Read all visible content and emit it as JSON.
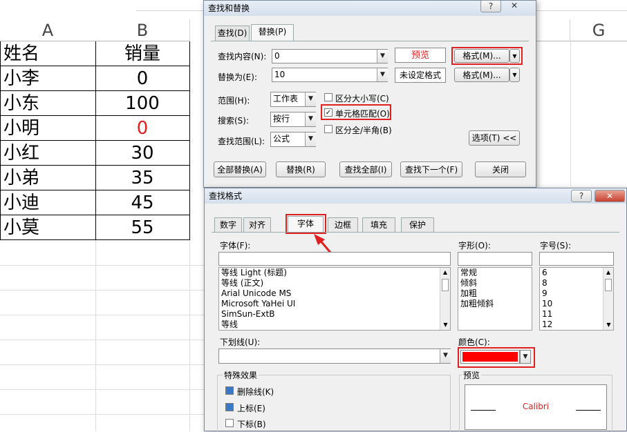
{
  "sheet": {
    "columns": {
      "a": "A",
      "b": "B",
      "g": "G"
    },
    "header_row": {
      "name": "姓名",
      "sales": "销量"
    },
    "rows": [
      {
        "name": "小李",
        "sales": "0"
      },
      {
        "name": "小东",
        "sales": "100"
      },
      {
        "name": "小明",
        "sales": "0"
      },
      {
        "name": "小红",
        "sales": "30"
      },
      {
        "name": "小弟",
        "sales": "35"
      },
      {
        "name": "小迪",
        "sales": "45"
      },
      {
        "name": "小莫",
        "sales": "55"
      }
    ],
    "red_value_color": "#e02020"
  },
  "replace_dialog": {
    "title": "查找和替换",
    "help": "?",
    "close": "✕",
    "tabs": {
      "find": "查找(D)",
      "replace": "替换(P)"
    },
    "find_label": "查找内容(N):",
    "find_value": "0",
    "replace_label": "替换为(E):",
    "replace_value": "10",
    "preview_label": "预览",
    "not_set_label": "未设定格式",
    "format_btn_1": "格式(M)...",
    "format_btn_2": "格式(M)...",
    "within_label": "范围(H):",
    "within_value": "工作表",
    "search_label": "搜索(S):",
    "search_value": "按行",
    "lookin_label": "查找范围(L):",
    "lookin_value": "公式",
    "match_case": "区分大小写(C)",
    "match_cell": "单元格匹配(O)",
    "match_width": "区分全/半角(B)",
    "options_btn": "选项(T) <<",
    "replace_all": "全部替换(A)",
    "replace": "替换(R)",
    "find_all": "查找全部(I)",
    "find_next": "查找下一个(F)",
    "close_btn": "关闭"
  },
  "format_dialog": {
    "title": "查找格式",
    "help": "?",
    "close": "✕",
    "tabs": [
      "数字",
      "对齐",
      "字体",
      "边框",
      "填充",
      "保护"
    ],
    "font_label": "字体(F):",
    "fonts": [
      "等线 Light (标题)",
      "等线 (正文)",
      "Arial Unicode MS",
      "Microsoft YaHei UI",
      "SimSun-ExtB",
      "等线"
    ],
    "style_label": "字形(O):",
    "styles": [
      "常规",
      "倾斜",
      "加粗",
      "加粗倾斜"
    ],
    "size_label": "字号(S):",
    "sizes": [
      "6",
      "8",
      "9",
      "10",
      "11",
      "12"
    ],
    "underline_label": "下划线(U):",
    "color_label": "颜色(C):",
    "color_value": "#ff0000",
    "effects_label": "特殊效果",
    "strike": "删除线(K)",
    "superscript": "上标(E)",
    "subscript": "下标(B)",
    "preview_label": "预览",
    "preview_text": "Calibri",
    "preview_color": "#e02020"
  }
}
